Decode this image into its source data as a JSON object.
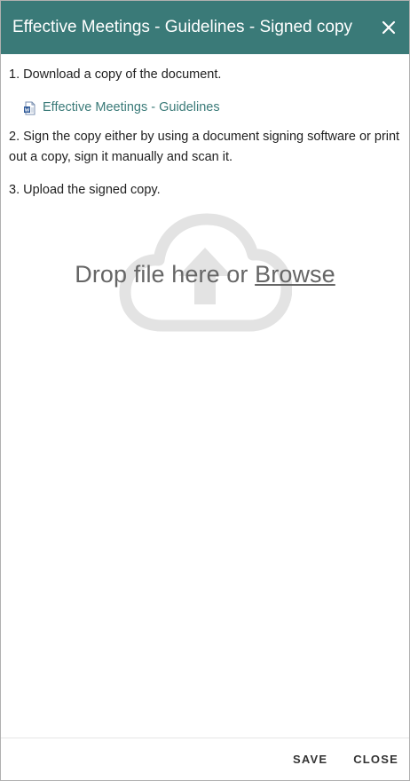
{
  "dialog": {
    "title": "Effective Meetings - Guidelines - Signed copy"
  },
  "steps": {
    "step1": "1. Download a copy of the document.",
    "document_link": "Effective Meetings - Guidelines",
    "step2": "2. Sign the copy either by using a document signing software or print out a copy, sign it manually and scan it.",
    "step3": "3. Upload the signed copy."
  },
  "dropzone": {
    "text": "Drop file here or",
    "browse": "Browse",
    "icon": "cloud-upload-icon"
  },
  "footer": {
    "save_label": "SAVE",
    "close_label": "CLOSE"
  },
  "colors": {
    "header_bg": "#3a7a78",
    "link": "#3a7a78"
  }
}
